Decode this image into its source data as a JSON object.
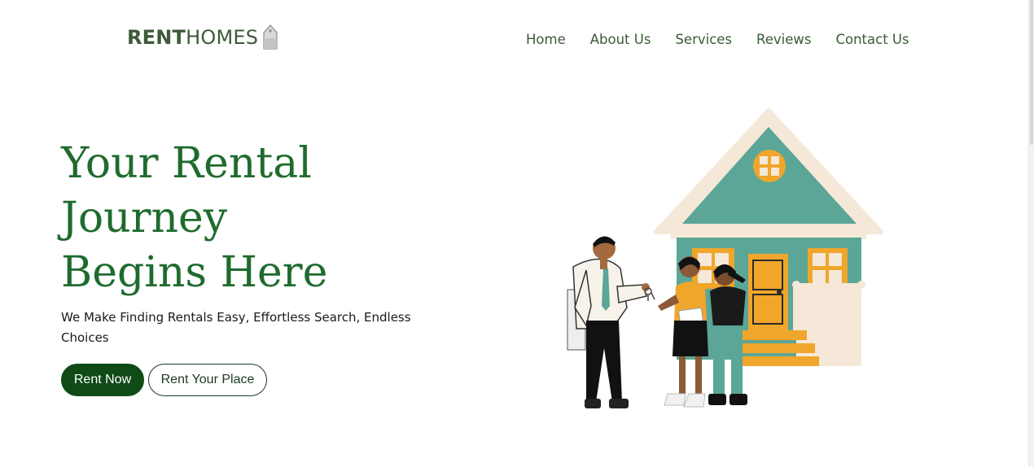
{
  "header": {
    "logo": {
      "bold": "RENT",
      "light": "HOMES",
      "icon": "house-tag-icon"
    },
    "nav": [
      "Home",
      "About Us",
      "Services",
      "Reviews",
      "Contact Us"
    ]
  },
  "hero": {
    "title_lines": [
      "Your Rental",
      "Journey",
      "Begins Here"
    ],
    "subtitle": "We Make Finding Rentals Easy, Effortless Search, Endless Choices",
    "buttons": {
      "primary": "Rent Now",
      "secondary": "Rent Your Place"
    },
    "illustration": "agent-handing-keys-to-family-in-front-of-house-illustration"
  },
  "colors": {
    "brand_green": "#1f6b2e",
    "button_dark_green": "#0f4a17",
    "nav_text": "#3b5a38",
    "house_teal": "#5ba696",
    "house_orange": "#f0a62b",
    "roof_cream": "#f5e8d8"
  }
}
